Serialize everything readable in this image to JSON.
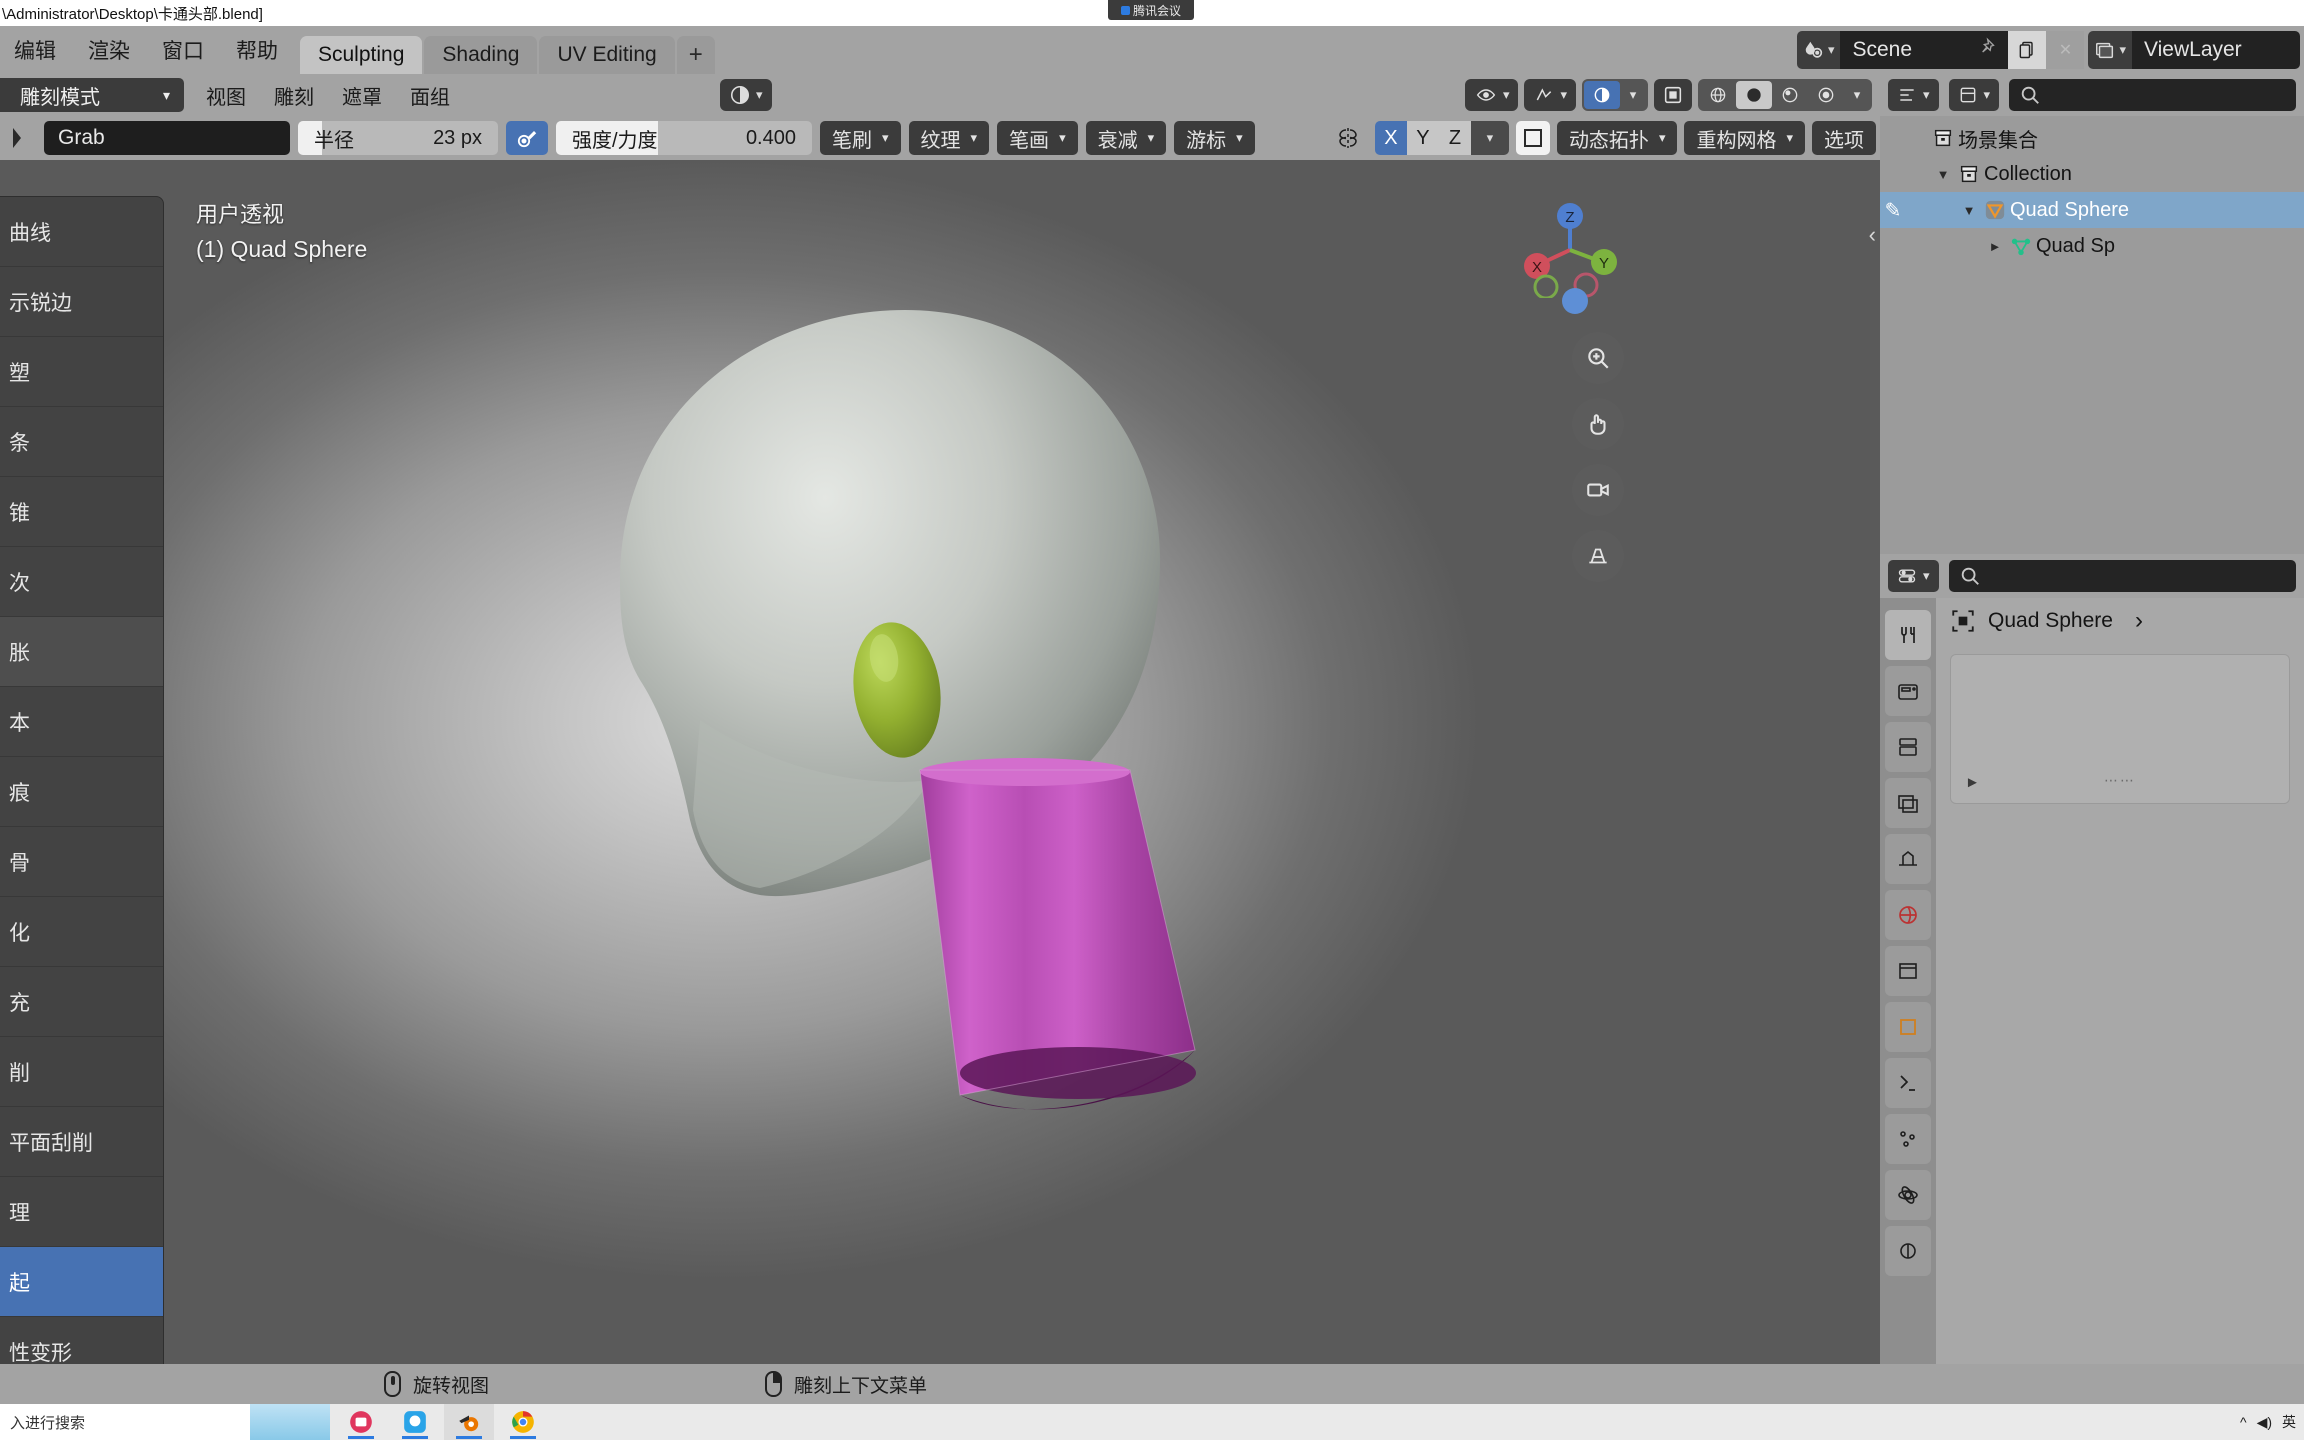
{
  "os": {
    "title": "\\Administrator\\Desktop\\卡通头部.blend]",
    "meeting_label": "腾讯会议"
  },
  "topbar": {
    "menus": [
      "编辑",
      "渲染",
      "窗口",
      "帮助"
    ],
    "workspace_tabs": [
      {
        "label": "Sculpting",
        "active": true
      },
      {
        "label": "Shading",
        "active": false
      },
      {
        "label": "UV Editing",
        "active": false
      }
    ],
    "add_tab_label": "+",
    "scene_name": "Scene",
    "view_layer_name": "ViewLayer"
  },
  "viewport_header": {
    "mode": "雕刻模式",
    "menus": [
      "视图",
      "雕刻",
      "遮罩",
      "面组"
    ]
  },
  "tool_settings": {
    "brush_name": "Grab",
    "radius_label": "半径",
    "radius_value": "23 px",
    "radius_fill_pct": 12,
    "pressure_icon": "pressure-radius-icon",
    "strength_label": "强度/力度",
    "strength_value": "0.400",
    "strength_fill_pct": 40,
    "dropdowns": [
      "笔刷",
      "纹理",
      "笔画",
      "衰减",
      "游标"
    ],
    "symmetry_axes": [
      {
        "label": "X",
        "active": true
      },
      {
        "label": "Y",
        "active": false
      },
      {
        "label": "Z",
        "active": false
      }
    ],
    "dyntopo_label": "动态拓扑",
    "remesh_label": "重构网格",
    "options_label": "选项"
  },
  "viewport": {
    "perspective_text": "用户透视",
    "object_text": "(1) Quad Sphere",
    "gizmo_axes": [
      {
        "label": "Z",
        "color": "#4f7fd0"
      },
      {
        "label": "X",
        "color": "#d04f5c"
      },
      {
        "label": "Y",
        "color": "#7db33f"
      }
    ],
    "nav_buttons": [
      "zoom-icon",
      "pan-icon",
      "camera-icon",
      "ortho-persp-icon"
    ],
    "model_colors": {
      "head": "#c8cbc6",
      "eye": "#93b030",
      "horn": "#c455c0"
    }
  },
  "left_toolbar": {
    "items": [
      {
        "label": "曲线",
        "state": "normal"
      },
      {
        "label": "示锐边",
        "state": "normal"
      },
      {
        "label": "塑",
        "state": "normal"
      },
      {
        "label": "条",
        "state": "normal"
      },
      {
        "label": "锥",
        "state": "normal"
      },
      {
        "label": "次",
        "state": "normal"
      },
      {
        "label": "胀",
        "state": "soft"
      },
      {
        "label": "本",
        "state": "normal"
      },
      {
        "label": "痕",
        "state": "normal"
      },
      {
        "label": "骨",
        "state": "normal"
      },
      {
        "label": "化",
        "state": "normal"
      },
      {
        "label": "充",
        "state": "normal"
      },
      {
        "label": "削",
        "state": "normal"
      },
      {
        "label": "平面刮削",
        "state": "normal"
      },
      {
        "label": "理",
        "state": "normal"
      },
      {
        "label": "起",
        "state": "highlight"
      },
      {
        "label": "性变形",
        "state": "normal"
      }
    ]
  },
  "outliner": {
    "search_placeholder": "",
    "rows": [
      {
        "label": "场景集合",
        "icon": "collection-icon",
        "indent": 0,
        "arrow": "",
        "selected": false
      },
      {
        "label": "Collection",
        "icon": "collection-icon",
        "indent": 1,
        "arrow": "▼",
        "selected": false
      },
      {
        "label": "Quad Sphere",
        "icon": "object-mesh-icon",
        "indent": 2,
        "arrow": "▼",
        "selected": true
      },
      {
        "label": "Quad Sp",
        "icon": "mesh-data-icon",
        "indent": 3,
        "arrow": "►",
        "selected": false
      }
    ]
  },
  "properties": {
    "breadcrumb": "Quad Sphere",
    "tabs": [
      "tool-icon",
      "render-icon",
      "output-icon",
      "viewlayer-icon",
      "scene-icon",
      "world-icon",
      "collection-icon",
      "object-icon",
      "modifier-icon",
      "particles-icon",
      "physics-icon",
      "constraint-icon"
    ]
  },
  "statusbar": {
    "items": [
      {
        "icon": "mouse-middle-icon",
        "label": "旋转视图"
      },
      {
        "icon": "mouse-right-icon",
        "label": "雕刻上下文菜单"
      }
    ]
  },
  "taskbar": {
    "search_placeholder": "入进行搜索",
    "apps": [
      "photos-icon",
      "uwp-icon",
      "blender-icon",
      "chrome-icon"
    ],
    "tray_text": "英"
  }
}
